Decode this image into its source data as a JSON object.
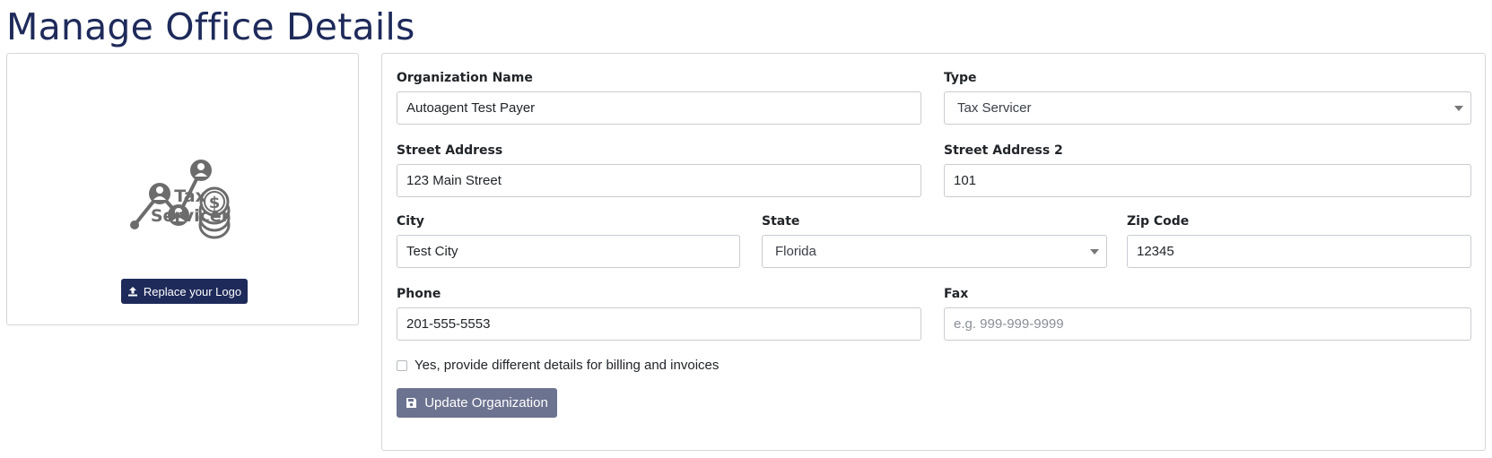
{
  "page": {
    "title": "Manage Office Details"
  },
  "logo_panel": {
    "logo_text_line1": "Tax",
    "logo_text_line2": "Servicer",
    "replace_button": "Replace your Logo",
    "replace_icon": "upload-icon"
  },
  "form": {
    "organization_name": {
      "label": "Organization Name",
      "value": "Autoagent Test Payer"
    },
    "type": {
      "label": "Type",
      "value": "Tax Servicer"
    },
    "street_address": {
      "label": "Street Address",
      "value": "123 Main Street"
    },
    "street_address_2": {
      "label": "Street Address 2",
      "value": "101"
    },
    "city": {
      "label": "City",
      "value": "Test City"
    },
    "state": {
      "label": "State",
      "value": "Florida"
    },
    "zip_code": {
      "label": "Zip Code",
      "value": "12345"
    },
    "phone": {
      "label": "Phone",
      "value": "201-555-5553"
    },
    "fax": {
      "label": "Fax",
      "value": "",
      "placeholder": "e.g. 999-999-9999"
    },
    "billing_checkbox": {
      "label": "Yes, provide different details for billing and invoices",
      "checked": false
    },
    "update_button": "Update Organization",
    "update_icon": "save-icon"
  },
  "colors": {
    "brand_navy": "#1e2a5a",
    "update_button_bg": "#6c7390",
    "logo_gray": "#6c6c6c"
  }
}
